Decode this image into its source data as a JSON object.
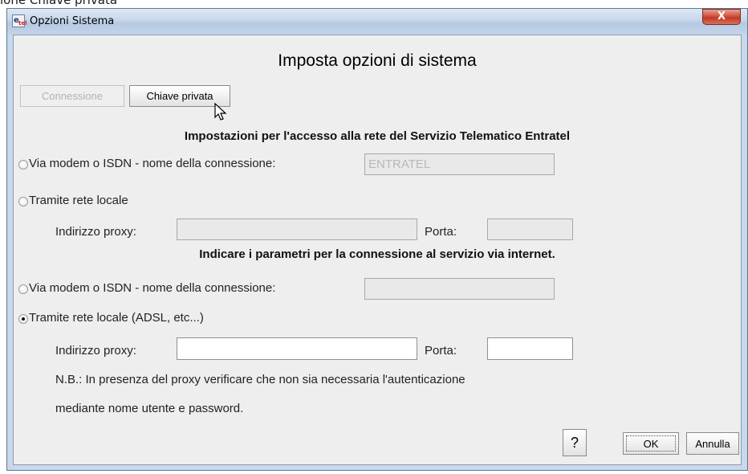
{
  "caption": "ione Chiave privata",
  "window": {
    "title": "Opzioni Sistema",
    "close_label": "X",
    "app_icon_letter": "e",
    "app_icon_sub": "tel"
  },
  "dialog": {
    "heading": "Imposta opzioni di sistema",
    "tabs": {
      "connessione": "Connessione",
      "chiave_privata": "Chiave privata"
    },
    "section_entratel": {
      "title": "Impostazioni per l'accesso alla rete del Servizio Telematico Entratel",
      "modem_label": "Via modem o ISDN - nome della connessione:",
      "modem_value": "ENTRATEL",
      "modem_selected": false,
      "lan_label": "Tramite rete locale",
      "lan_selected": false,
      "proxy_label": "Indirizzo proxy:",
      "proxy_value": "",
      "port_label": "Porta:",
      "port_value": ""
    },
    "section_internet": {
      "title": "Indicare i parametri per la connessione al servizio via internet.",
      "modem_label": "Via modem o ISDN - nome della connessione:",
      "modem_value": "",
      "modem_selected": false,
      "lan_label": "Tramite rete locale (ADSL, etc...)",
      "lan_selected": true,
      "proxy_label": "Indirizzo proxy:",
      "proxy_value": "",
      "port_label": "Porta:",
      "port_value": ""
    },
    "note_line1": "N.B.: In presenza del proxy verificare che non sia necessaria l'autenticazione",
    "note_line2": "mediante nome utente e password.",
    "help_label": "?",
    "ok_label": "OK",
    "cancel_label": "Annulla"
  }
}
